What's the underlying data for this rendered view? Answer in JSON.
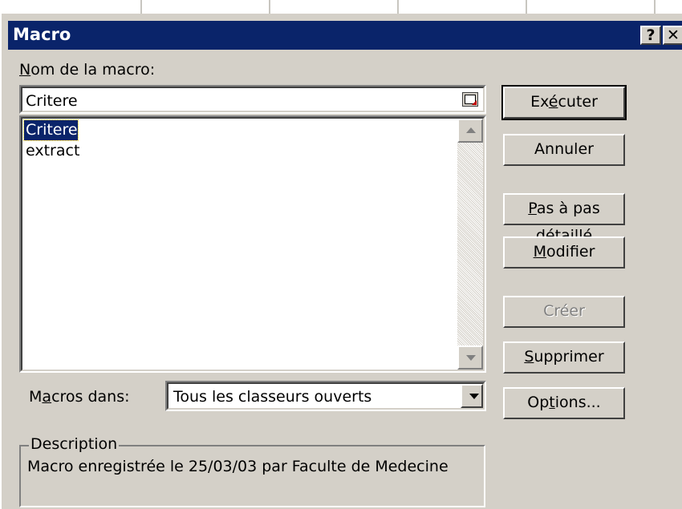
{
  "window": {
    "title_first": "M",
    "title_rest": "acro",
    "help_glyph": "?",
    "close_glyph": "✕"
  },
  "name_label": {
    "underline": "N",
    "rest": "om de la macro:"
  },
  "name_field": {
    "value": "Critere"
  },
  "macro_list": {
    "items": [
      "Critere",
      "extract"
    ],
    "selected_index": 0
  },
  "buttons": {
    "run": {
      "pre": "Ex",
      "ul": "é",
      "post": "cuter"
    },
    "cancel": {
      "label": "Annuler"
    },
    "step_into": {
      "pre": "",
      "ul": "P",
      "post": "as à pas détaillé"
    },
    "edit": {
      "pre": "",
      "ul": "M",
      "post": "odifier"
    },
    "create": {
      "label": "Créer"
    },
    "delete": {
      "pre": "",
      "ul": "S",
      "post": "upprimer"
    },
    "options": {
      "pre": "Op",
      "ul": "t",
      "post": "ions..."
    }
  },
  "macros_in": {
    "label_pre": "M",
    "label_ul": "a",
    "label_post": "cros dans:",
    "selected": "Tous les classeurs ouverts"
  },
  "description": {
    "legend": "Description",
    "text": "Macro enregistrée le 25/03/03 par Faculte de Medecine"
  },
  "colors": {
    "titlebar": "#0a246a",
    "face": "#d4d0c8",
    "selection": "#0a246a"
  }
}
